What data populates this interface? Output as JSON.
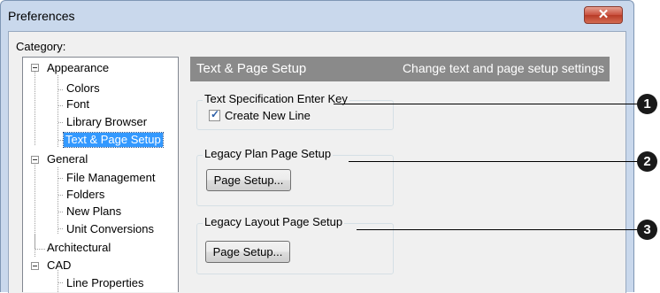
{
  "window": {
    "title": "Preferences",
    "close_glyph": "✕"
  },
  "category_label": "Category:",
  "tree": {
    "appearance": "Appearance",
    "colors": "Colors",
    "font": "Font",
    "library_browser": "Library Browser",
    "text_page_setup": "Text & Page Setup",
    "general": "General",
    "file_management": "File Management",
    "folders": "Folders",
    "new_plans": "New Plans",
    "unit_conversions": "Unit Conversions",
    "architectural": "Architectural",
    "cad": "CAD",
    "line_properties": "Line Properties"
  },
  "panel": {
    "title": "Text & Page Setup",
    "description": "Change text and page setup settings",
    "text_spec": {
      "label": "Text Specification Enter Key",
      "checkbox_label": "Create New Line",
      "checked": true
    },
    "legacy_plan": {
      "label": "Legacy Plan Page Setup",
      "button": "Page Setup..."
    },
    "legacy_layout": {
      "label": "Legacy Layout Page Setup",
      "button": "Page Setup..."
    }
  },
  "callouts": [
    "1",
    "2",
    "3"
  ],
  "colors": {
    "header_bg": "#8a8a8a",
    "selection": "#3399ff",
    "close_red": "#c9503d"
  }
}
